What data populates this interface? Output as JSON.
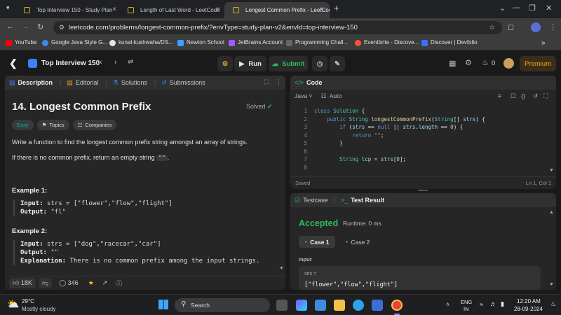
{
  "browser": {
    "tabs": [
      {
        "title": "Top Interview 150 - Study Plan",
        "active": false
      },
      {
        "title": "Length of Last Word - LeetCode",
        "active": false
      },
      {
        "title": "Longest Common Prefix - LeetCode",
        "active": true
      }
    ],
    "new_tab": "+",
    "url": "leetcode.com/problems/longest-common-prefix/?envType=study-plan-v2&envId=top-interview-150"
  },
  "bookmarks": [
    {
      "label": "YouTube",
      "color": "#ff0000"
    },
    {
      "label": "Google Java Style G...",
      "color": "#4285f4"
    },
    {
      "label": "kunal-kushwaha/DS...",
      "color": "#e6e6e6"
    },
    {
      "label": "Newton School",
      "color": "#3aa0ff"
    },
    {
      "label": "JetBrains Account",
      "color": "#a05cf5"
    },
    {
      "label": "Programming Chall...",
      "color": "#666666"
    },
    {
      "label": "Eventbrite - Discove...",
      "color": "#f05537"
    },
    {
      "label": "Discover | Devfolio",
      "color": "#3770ff"
    }
  ],
  "header": {
    "study_plan": "Top Interview 150",
    "run_label": "Run",
    "submit_label": "Submit",
    "streak_count": "0",
    "premium_label": "Premium"
  },
  "left_panel": {
    "tabs": [
      "Description",
      "Editorial",
      "Solutions",
      "Submissions"
    ],
    "title": "14. Longest Common Prefix",
    "solved_label": "Solved",
    "difficulty": "Easy",
    "topics_label": "Topics",
    "companies_label": "Companies",
    "desc_1": "Write a function to find the longest common prefix string amongst an array of strings.",
    "desc_2_prefix": "If there is no common prefix, return an empty string ",
    "desc_2_code": "\"\"",
    "desc_2_suffix": ".",
    "example1_title": "Example 1:",
    "example1_input_label": "Input:",
    "example1_input": " strs = [\"flower\",\"flow\",\"flight\"]",
    "example1_output_label": "Output:",
    "example1_output": " \"fl\"",
    "example2_title": "Example 2:",
    "example2_input_label": "Input:",
    "example2_input": " strs = [\"dog\",\"racecar\",\"car\"]",
    "example2_output_label": "Output:",
    "example2_output": " \"\"",
    "example2_expl_label": "Explanation:",
    "example2_expl": " There is no common prefix among the input strings.",
    "likes": "18K",
    "comments": "346"
  },
  "code_panel": {
    "title": "Code",
    "language": "Java",
    "auto_label": "Auto",
    "status": "Saved",
    "cursor": "Ln 1, Col 1"
  },
  "result_panel": {
    "testcase_label": "Testcase",
    "result_label": "Test Result",
    "verdict": "Accepted",
    "runtime": "Runtime: 0 ms",
    "case1": "Case 1",
    "case2": "Case 2",
    "input_label": "Input",
    "var_label": "strs =",
    "var_value": "[\"flower\",\"flow\",\"flight\"]"
  },
  "taskbar": {
    "temp": "29°C",
    "weather": "Mostly cloudy",
    "search": "Search",
    "lang_1": "ENG",
    "lang_2": "IN",
    "time": "12:20 AM",
    "date": "28-09-2024"
  }
}
